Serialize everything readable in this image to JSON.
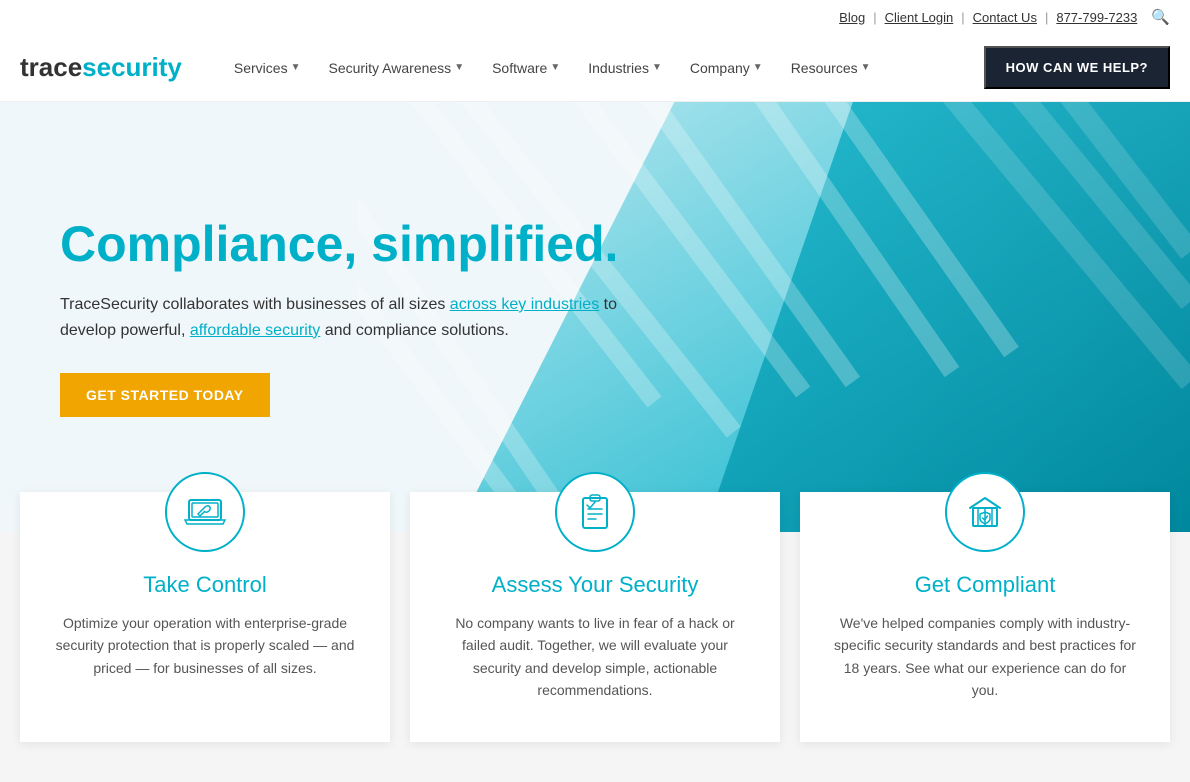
{
  "topbar": {
    "blog_label": "Blog",
    "client_login_label": "Client Login",
    "contact_us_label": "Contact Us",
    "phone": "877-799-7233"
  },
  "nav": {
    "logo_trace": "trace",
    "logo_security": "security",
    "items": [
      {
        "label": "Services",
        "id": "services"
      },
      {
        "label": "Security Awareness",
        "id": "security-awareness"
      },
      {
        "label": "Software",
        "id": "software"
      },
      {
        "label": "Industries",
        "id": "industries"
      },
      {
        "label": "Company",
        "id": "company"
      },
      {
        "label": "Resources",
        "id": "resources"
      }
    ],
    "cta_label": "HOW CAN WE HELP?"
  },
  "hero": {
    "title": "Compliance, simplified.",
    "desc_prefix": "TraceSecurity collaborates with businesses of all sizes ",
    "desc_link1": "across key industries",
    "desc_middle": " to develop powerful, ",
    "desc_link2": "affordable security",
    "desc_suffix": " and compliance solutions.",
    "cta_label": "GET STARTED TODAY"
  },
  "cards": [
    {
      "id": "take-control",
      "title": "Take Control",
      "desc": "Optimize your operation with enterprise-grade security protection that is properly scaled — and priced — for businesses of all sizes."
    },
    {
      "id": "assess-security",
      "title": "Assess Your Security",
      "desc": "No company wants to live in fear of a hack or failed audit. Together, we will evaluate your security and develop simple, actionable recommendations."
    },
    {
      "id": "get-compliant",
      "title": "Get Compliant",
      "desc": "We've helped companies comply with industry-specific security standards and best practices for 18 years. See what our experience can do for you."
    }
  ],
  "colors": {
    "teal": "#00b0c8",
    "dark_teal": "#007a8f",
    "navy": "#1a2433",
    "gold": "#f0a500",
    "light_bg": "#f0f7fa"
  }
}
